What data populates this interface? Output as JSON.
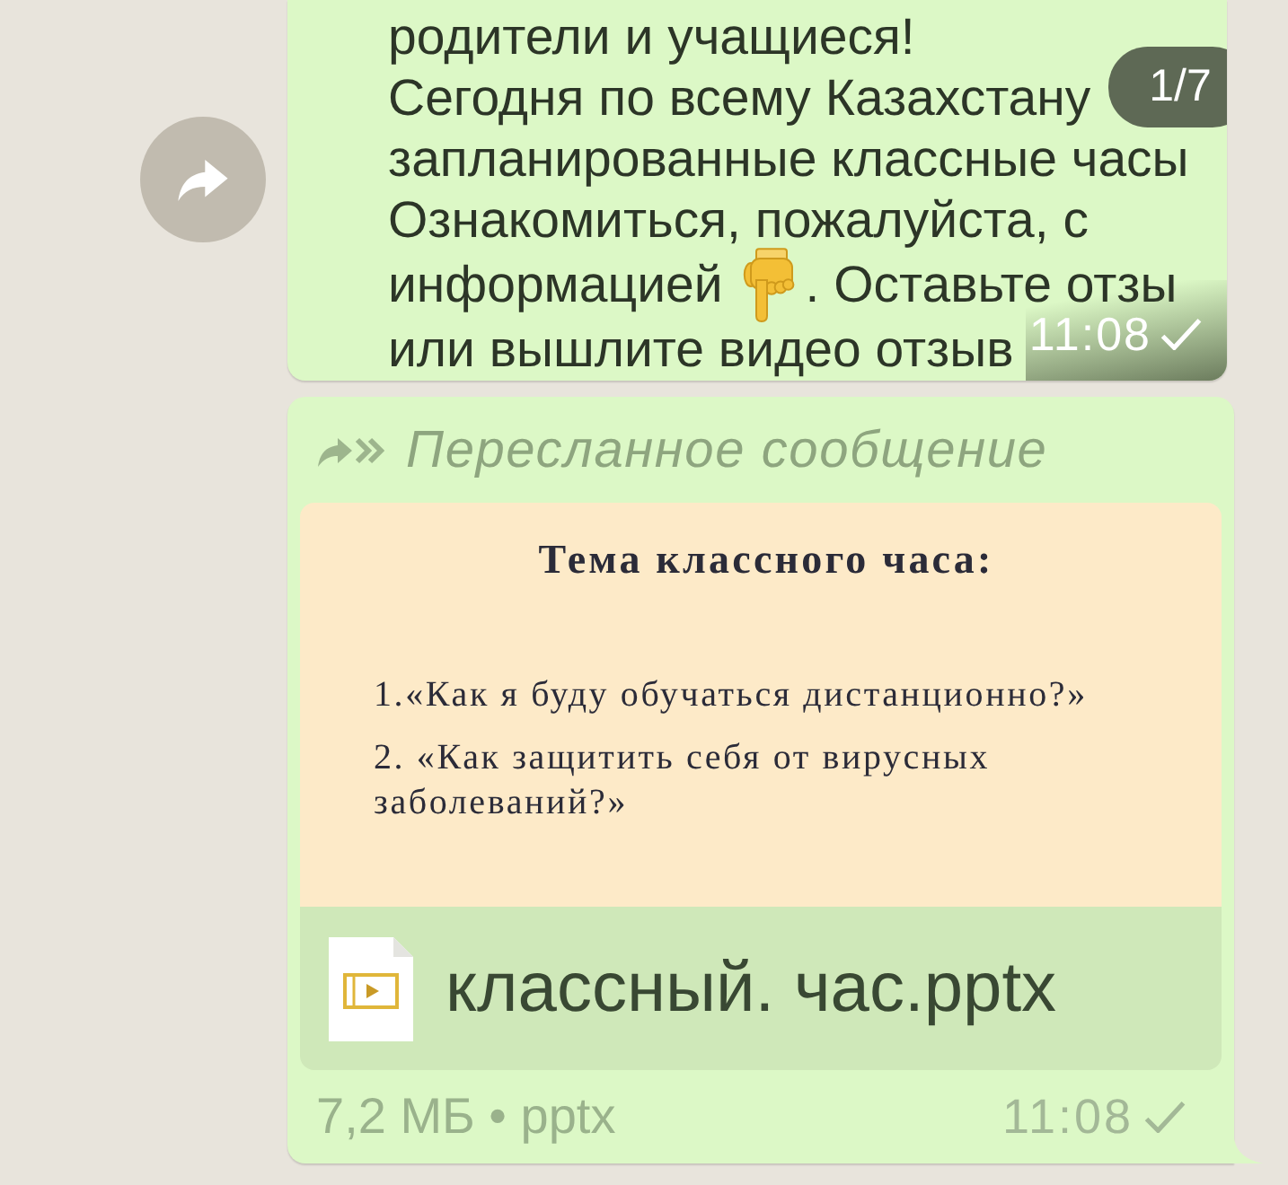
{
  "messages": [
    {
      "kind": "text",
      "forward_button": true,
      "lines": [
        [
          {
            "kind": "text",
            "text": "родители и учащиеся!"
          }
        ],
        [
          {
            "kind": "text",
            "text": "Сегодня по всему Казахстану"
          }
        ],
        [
          {
            "kind": "text",
            "text": "запланированные классные часы"
          }
        ],
        [
          {
            "kind": "text",
            "text": "Ознакомиться, пожалуйста, с"
          }
        ],
        [
          {
            "kind": "text",
            "text": "информацией"
          },
          {
            "kind": "icon"
          },
          {
            "kind": "text",
            "text": ". Оставьте отзы"
          }
        ],
        [
          {
            "kind": "text",
            "text": "или вышлите видео отзыв"
          }
        ]
      ],
      "counter": "1/7",
      "time": "11:08",
      "delivered": false
    },
    {
      "kind": "document",
      "forward_button": false,
      "forwarded": {
        "label": "Пересланное сообщение"
      },
      "preview": {
        "title": "Тема классного часа:",
        "items": [
          "1.«Как я буду обучаться дистанционно?»",
          "2. «Как защитить себя от вирусных заболеваний?»"
        ]
      },
      "file_name": "классный. час.pptx",
      "file_info": "7,2 МБ • pptx",
      "time": "11:08",
      "delivered": false
    }
  ]
}
